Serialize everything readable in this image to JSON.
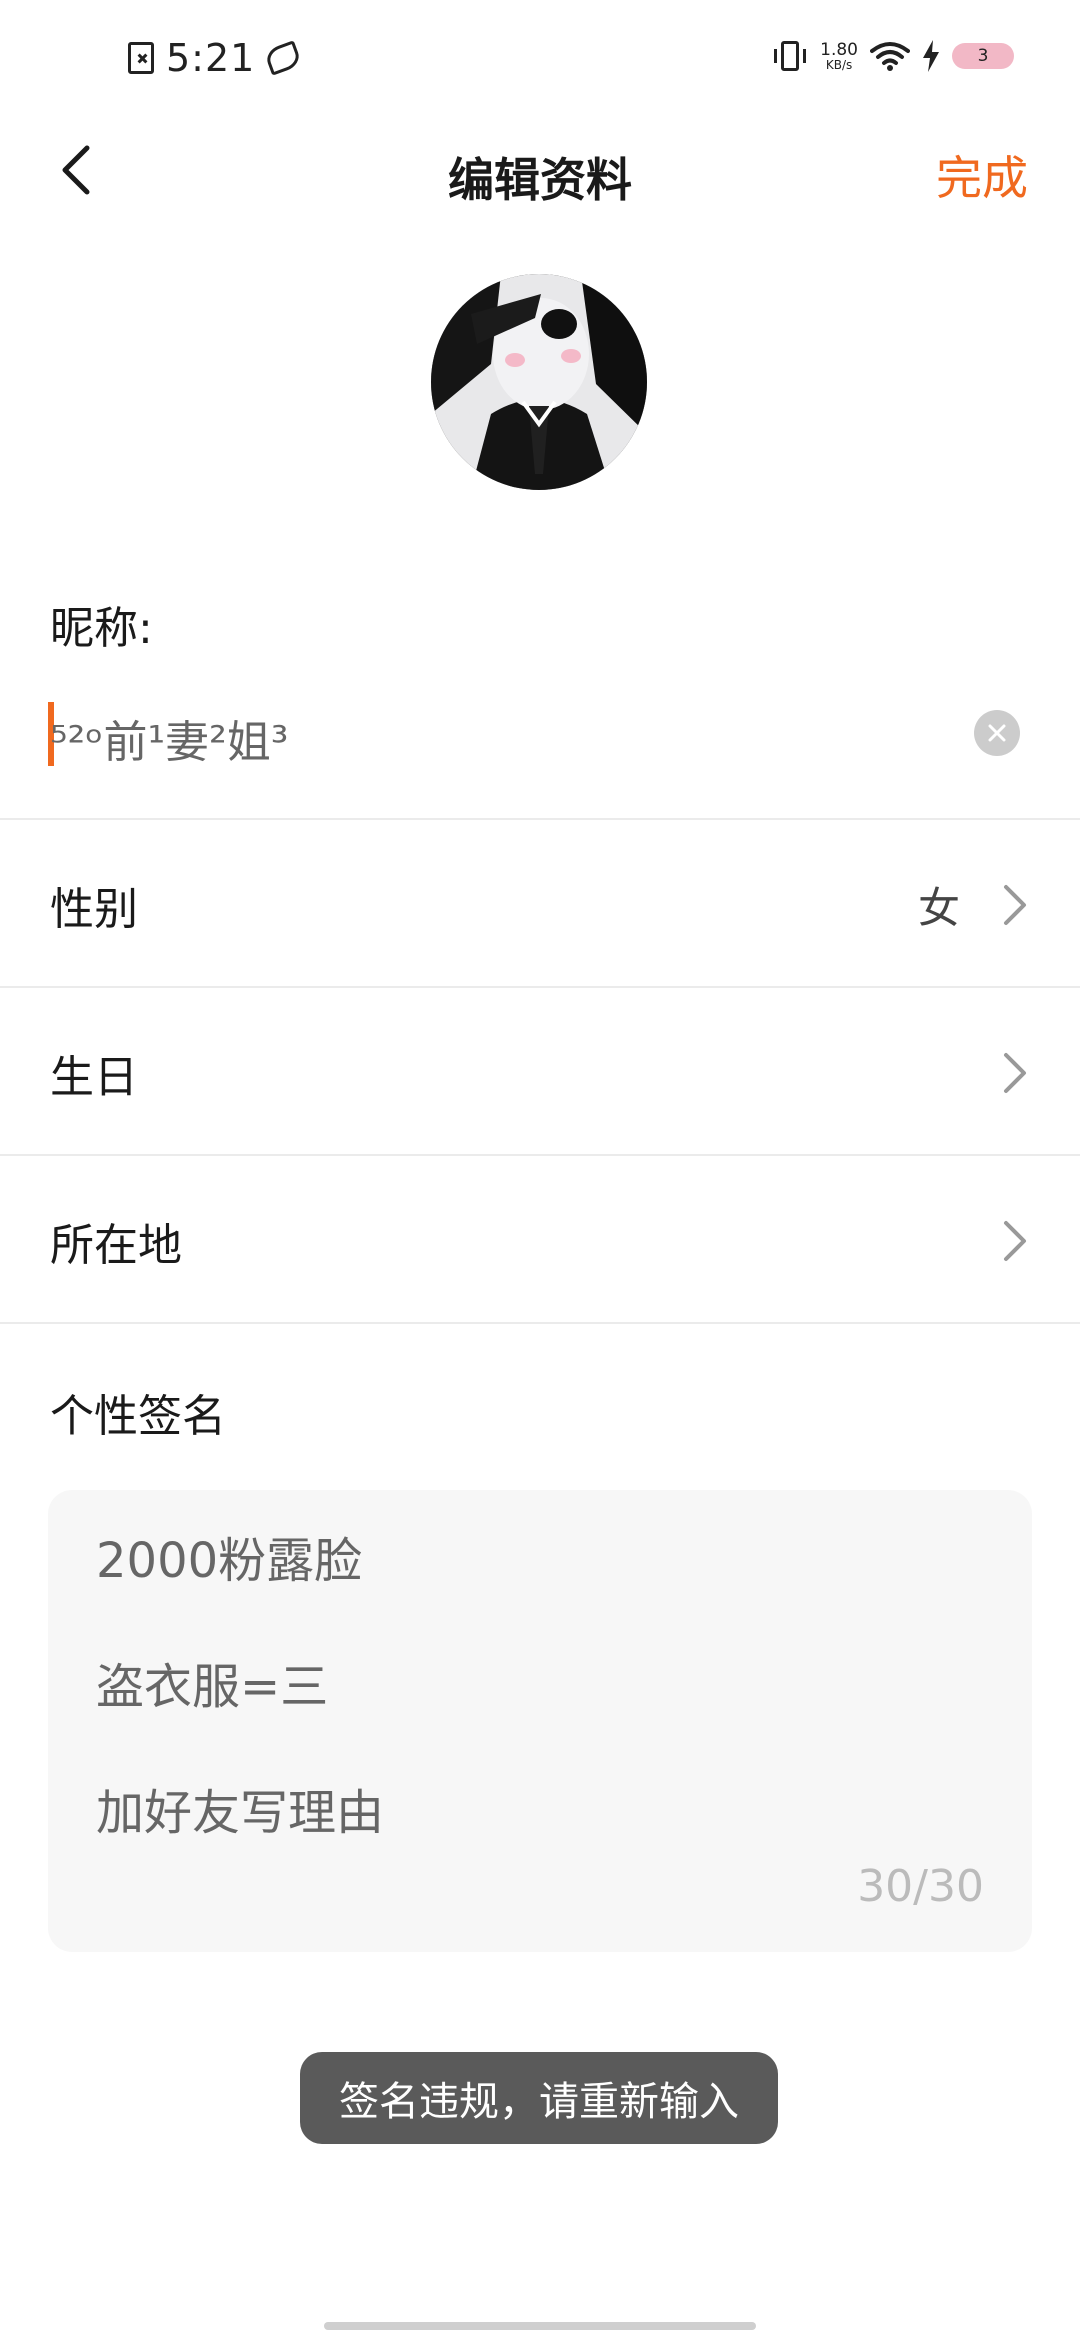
{
  "status_bar": {
    "time": "5:21",
    "net_speed_value": "1.80",
    "net_speed_unit": "KB/s",
    "battery_level": "3"
  },
  "nav": {
    "title": "编辑资料",
    "done_label": "完成"
  },
  "colors": {
    "accent": "#f0691f",
    "toast_bg": "#5a5a5a",
    "divider": "#ebebeb"
  },
  "nickname": {
    "label": "昵称:",
    "value": "⁵²ᵒ前¹妻²姐³"
  },
  "rows": [
    {
      "label": "性别",
      "value": "女"
    },
    {
      "label": "生日",
      "value": ""
    },
    {
      "label": "所在地",
      "value": ""
    }
  ],
  "signature": {
    "label": "个性签名",
    "text": "2000粉露脸\n盗衣服=三\n加好友写理由",
    "counter": "30/30"
  },
  "toast": {
    "message": "签名违规，请重新输入"
  }
}
